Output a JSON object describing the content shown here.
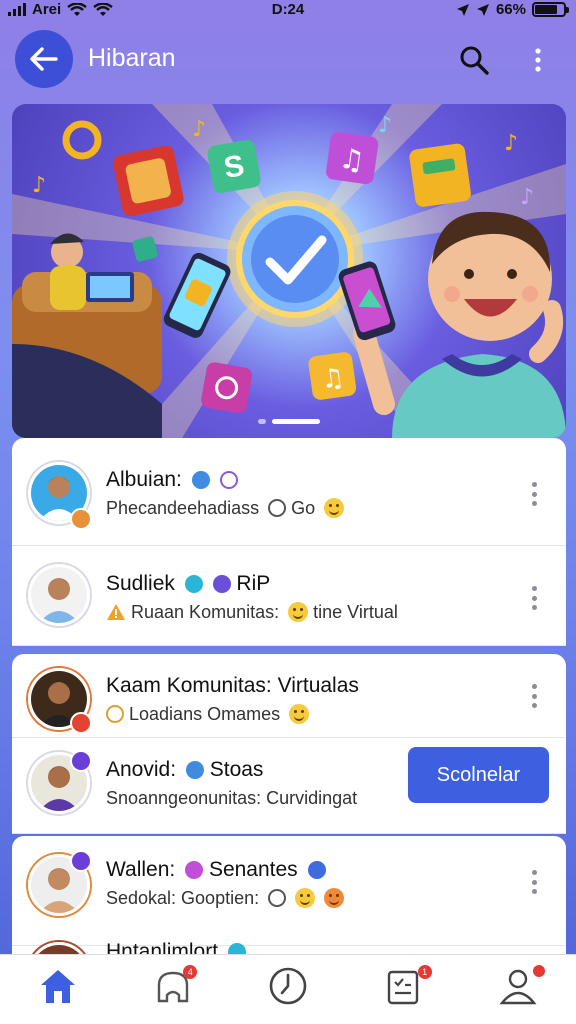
{
  "status": {
    "carrier": "Arei",
    "time": "D:24",
    "battery": "66%"
  },
  "header": {
    "title": "Hibaran",
    "back_icon": "arrow-left-icon",
    "search_icon": "search-icon",
    "more_icon": "more-vertical-icon"
  },
  "banner": {
    "slides": 3,
    "active_slide": 2
  },
  "list": {
    "items": [
      {
        "name": "Albuian:",
        "subtitle": "Phecandeehadiass",
        "subtitle_tail": "Go"
      },
      {
        "name": "Sudliek",
        "name_tail": "RiP",
        "subtitle": "Ruaan Komunitas:",
        "subtitle_tail": "tine Virtual"
      },
      {
        "name": "Kaam Komunitas: Virtualas",
        "subtitle": "Loadians Omames"
      },
      {
        "name": "Anovid:",
        "name_tail": "Stoas",
        "subtitle": "Snoanngeonunitas: Curvidingat",
        "button": "Scolnelar"
      },
      {
        "name": "Wallen:",
        "name_tail": "Senantes",
        "subtitle": "Sedokal: Gooptien:"
      },
      {
        "name": "Hntanlimlort"
      }
    ]
  },
  "nav": {
    "items": [
      {
        "icon": "home-icon",
        "label": "",
        "badge": ""
      },
      {
        "icon": "community-icon",
        "label": "",
        "badge": "4"
      },
      {
        "icon": "compass-icon",
        "label": "",
        "badge": ""
      },
      {
        "icon": "clipboard-icon",
        "label": "",
        "badge": "1"
      },
      {
        "icon": "profile-icon",
        "label": "",
        "badge": ""
      }
    ]
  },
  "colors": {
    "accent": "#3e5fe0",
    "header_btn": "#3d4fd6",
    "badge": "#e53935"
  }
}
